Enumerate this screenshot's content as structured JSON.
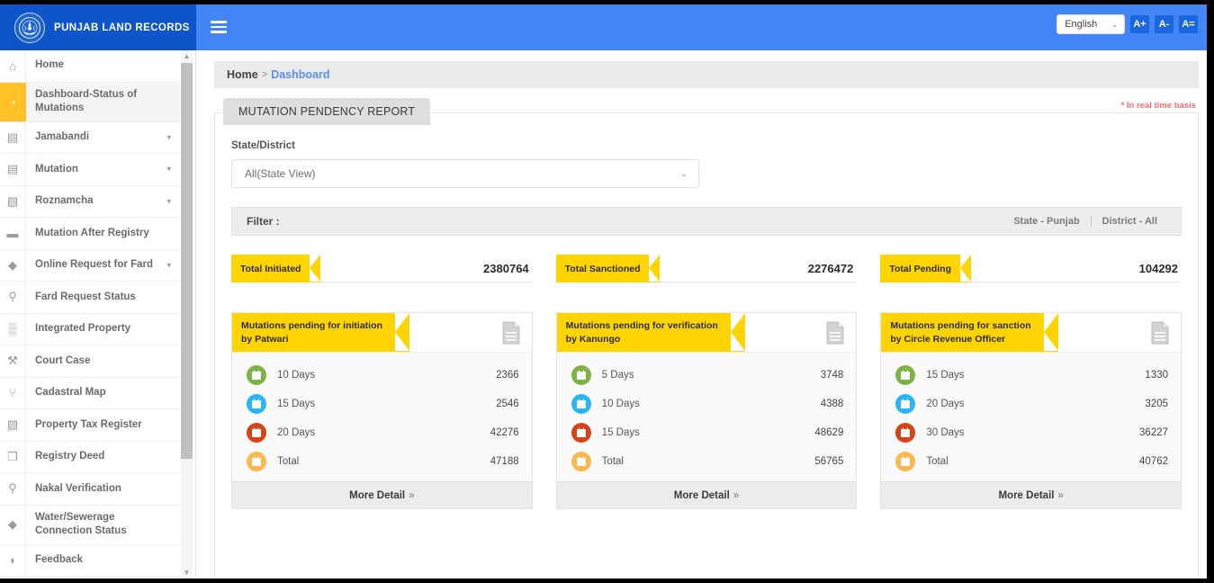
{
  "header": {
    "brand_title": "PUNJAB LAND RECORDS",
    "emblem_icon": "punjab-state-emblem",
    "menu_icon": "hamburger-menu-icon",
    "language": "English",
    "language_caret": "⌄",
    "font_increase": "A+",
    "font_decrease": "A-",
    "font_reset": "A="
  },
  "sidebar": {
    "items": [
      {
        "label": "Home",
        "icon": "home-icon",
        "glyph": "⌂",
        "caret": false,
        "active": false
      },
      {
        "label": "Dashboard-Status of Mutations",
        "icon": "dashboard-gauge-icon",
        "glyph": "◔",
        "caret": false,
        "active": true
      },
      {
        "label": "Jamabandi",
        "icon": "id-card-icon",
        "glyph": "▤",
        "caret": true,
        "active": false
      },
      {
        "label": "Mutation",
        "icon": "document-icon",
        "glyph": "▤",
        "caret": true,
        "active": false
      },
      {
        "label": "Roznamcha",
        "icon": "book-icon",
        "glyph": "▧",
        "caret": true,
        "active": false
      },
      {
        "label": "Mutation After Registry",
        "icon": "briefcase-icon",
        "glyph": "▬",
        "caret": false,
        "active": false
      },
      {
        "label": "Online Request for Fard",
        "icon": "water-drop-icon",
        "glyph": "◆",
        "caret": true,
        "active": false
      },
      {
        "label": "Fard Request Status",
        "icon": "search-icon",
        "glyph": "⚲",
        "caret": false,
        "active": false
      },
      {
        "label": "Integrated Property",
        "icon": "bank-icon",
        "glyph": "▒",
        "caret": false,
        "active": false
      },
      {
        "label": "Court Case",
        "icon": "gavel-icon",
        "glyph": "⚒",
        "caret": false,
        "active": false
      },
      {
        "label": "Cadastral Map",
        "icon": "map-pin-icon",
        "glyph": "⑂",
        "caret": false,
        "active": false
      },
      {
        "label": "Property Tax Register",
        "icon": "edit-square-icon",
        "glyph": "▨",
        "caret": false,
        "active": false
      },
      {
        "label": "Registry Deed",
        "icon": "copy-pages-icon",
        "glyph": "❐",
        "caret": false,
        "active": false
      },
      {
        "label": "Nakal Verification",
        "icon": "search-icon",
        "glyph": "⚲",
        "caret": false,
        "active": false
      },
      {
        "label": "Water/Sewerage Connection Status",
        "icon": "water-drop-icon",
        "glyph": "◆",
        "caret": false,
        "active": false
      },
      {
        "label": "Feedback",
        "icon": "chat-bubble-icon",
        "glyph": "◗",
        "caret": false,
        "active": false
      }
    ],
    "scroll_up_icon": "scroll-up-arrow",
    "scroll_down_icon": "scroll-down-arrow"
  },
  "breadcrumb": {
    "home": "Home",
    "separator": ">",
    "current": "Dashboard"
  },
  "panel": {
    "realtime_note": "* In real time basis",
    "tab_title": "MUTATION PENDENCY REPORT",
    "form_label": "State/District",
    "select_value": "All(State View)",
    "select_caret": "⌄",
    "filter_label": "Filter :",
    "filter_state": "State - Punjab",
    "filter_district": "District - All"
  },
  "totals": [
    {
      "label": "Total Initiated",
      "value": "2380764"
    },
    {
      "label": "Total Sanctioned",
      "value": "2276472"
    },
    {
      "label": "Total Pending",
      "value": "104292"
    }
  ],
  "cards": [
    {
      "title_line1": "Mutations pending for initiation",
      "title_line2": "by Patwari",
      "doc_icon": "document-lines-icon",
      "rows": [
        {
          "label": "10 Days",
          "value": "2366",
          "color": "#7cb342",
          "icon": "calendar-icon"
        },
        {
          "label": "15 Days",
          "value": "2546",
          "color": "#29b6f6",
          "icon": "calendar-icon"
        },
        {
          "label": "20 Days",
          "value": "42276",
          "color": "#d84315",
          "icon": "calendar-icon"
        },
        {
          "label": "Total",
          "value": "47188",
          "color": "#ffb74d",
          "icon": "calendar-icon"
        }
      ],
      "more_detail": "More Detail",
      "more_chevron": "»"
    },
    {
      "title_line1": "Mutations pending for verification",
      "title_line2": "by Kanungo",
      "doc_icon": "document-lines-icon",
      "rows": [
        {
          "label": "5 Days",
          "value": "3748",
          "color": "#7cb342",
          "icon": "calendar-icon"
        },
        {
          "label": "10 Days",
          "value": "4388",
          "color": "#29b6f6",
          "icon": "calendar-icon"
        },
        {
          "label": "15 Days",
          "value": "48629",
          "color": "#d84315",
          "icon": "calendar-icon"
        },
        {
          "label": "Total",
          "value": "56765",
          "color": "#ffb74d",
          "icon": "calendar-icon"
        }
      ],
      "more_detail": "More Detail",
      "more_chevron": "»"
    },
    {
      "title_line1": "Mutations pending for sanction",
      "title_line2": "by Circle Revenue Officer",
      "doc_icon": "document-lines-icon",
      "rows": [
        {
          "label": "15 Days",
          "value": "1330",
          "color": "#7cb342",
          "icon": "calendar-icon"
        },
        {
          "label": "20 Days",
          "value": "3205",
          "color": "#29b6f6",
          "icon": "calendar-icon"
        },
        {
          "label": "30 Days",
          "value": "36227",
          "color": "#d84315",
          "icon": "calendar-icon"
        },
        {
          "label": "Total",
          "value": "40762",
          "color": "#ffb74d",
          "icon": "calendar-icon"
        }
      ],
      "more_detail": "More Detail",
      "more_chevron": "»"
    }
  ],
  "colors": {
    "brand_dark_blue": "#0d55c8",
    "header_blue": "#4285f4",
    "accent_yellow": "#ffd400",
    "active_item_yellow": "#ffc125",
    "link_blue": "#5a8ff0",
    "alert_red": "#ff6b6b"
  }
}
